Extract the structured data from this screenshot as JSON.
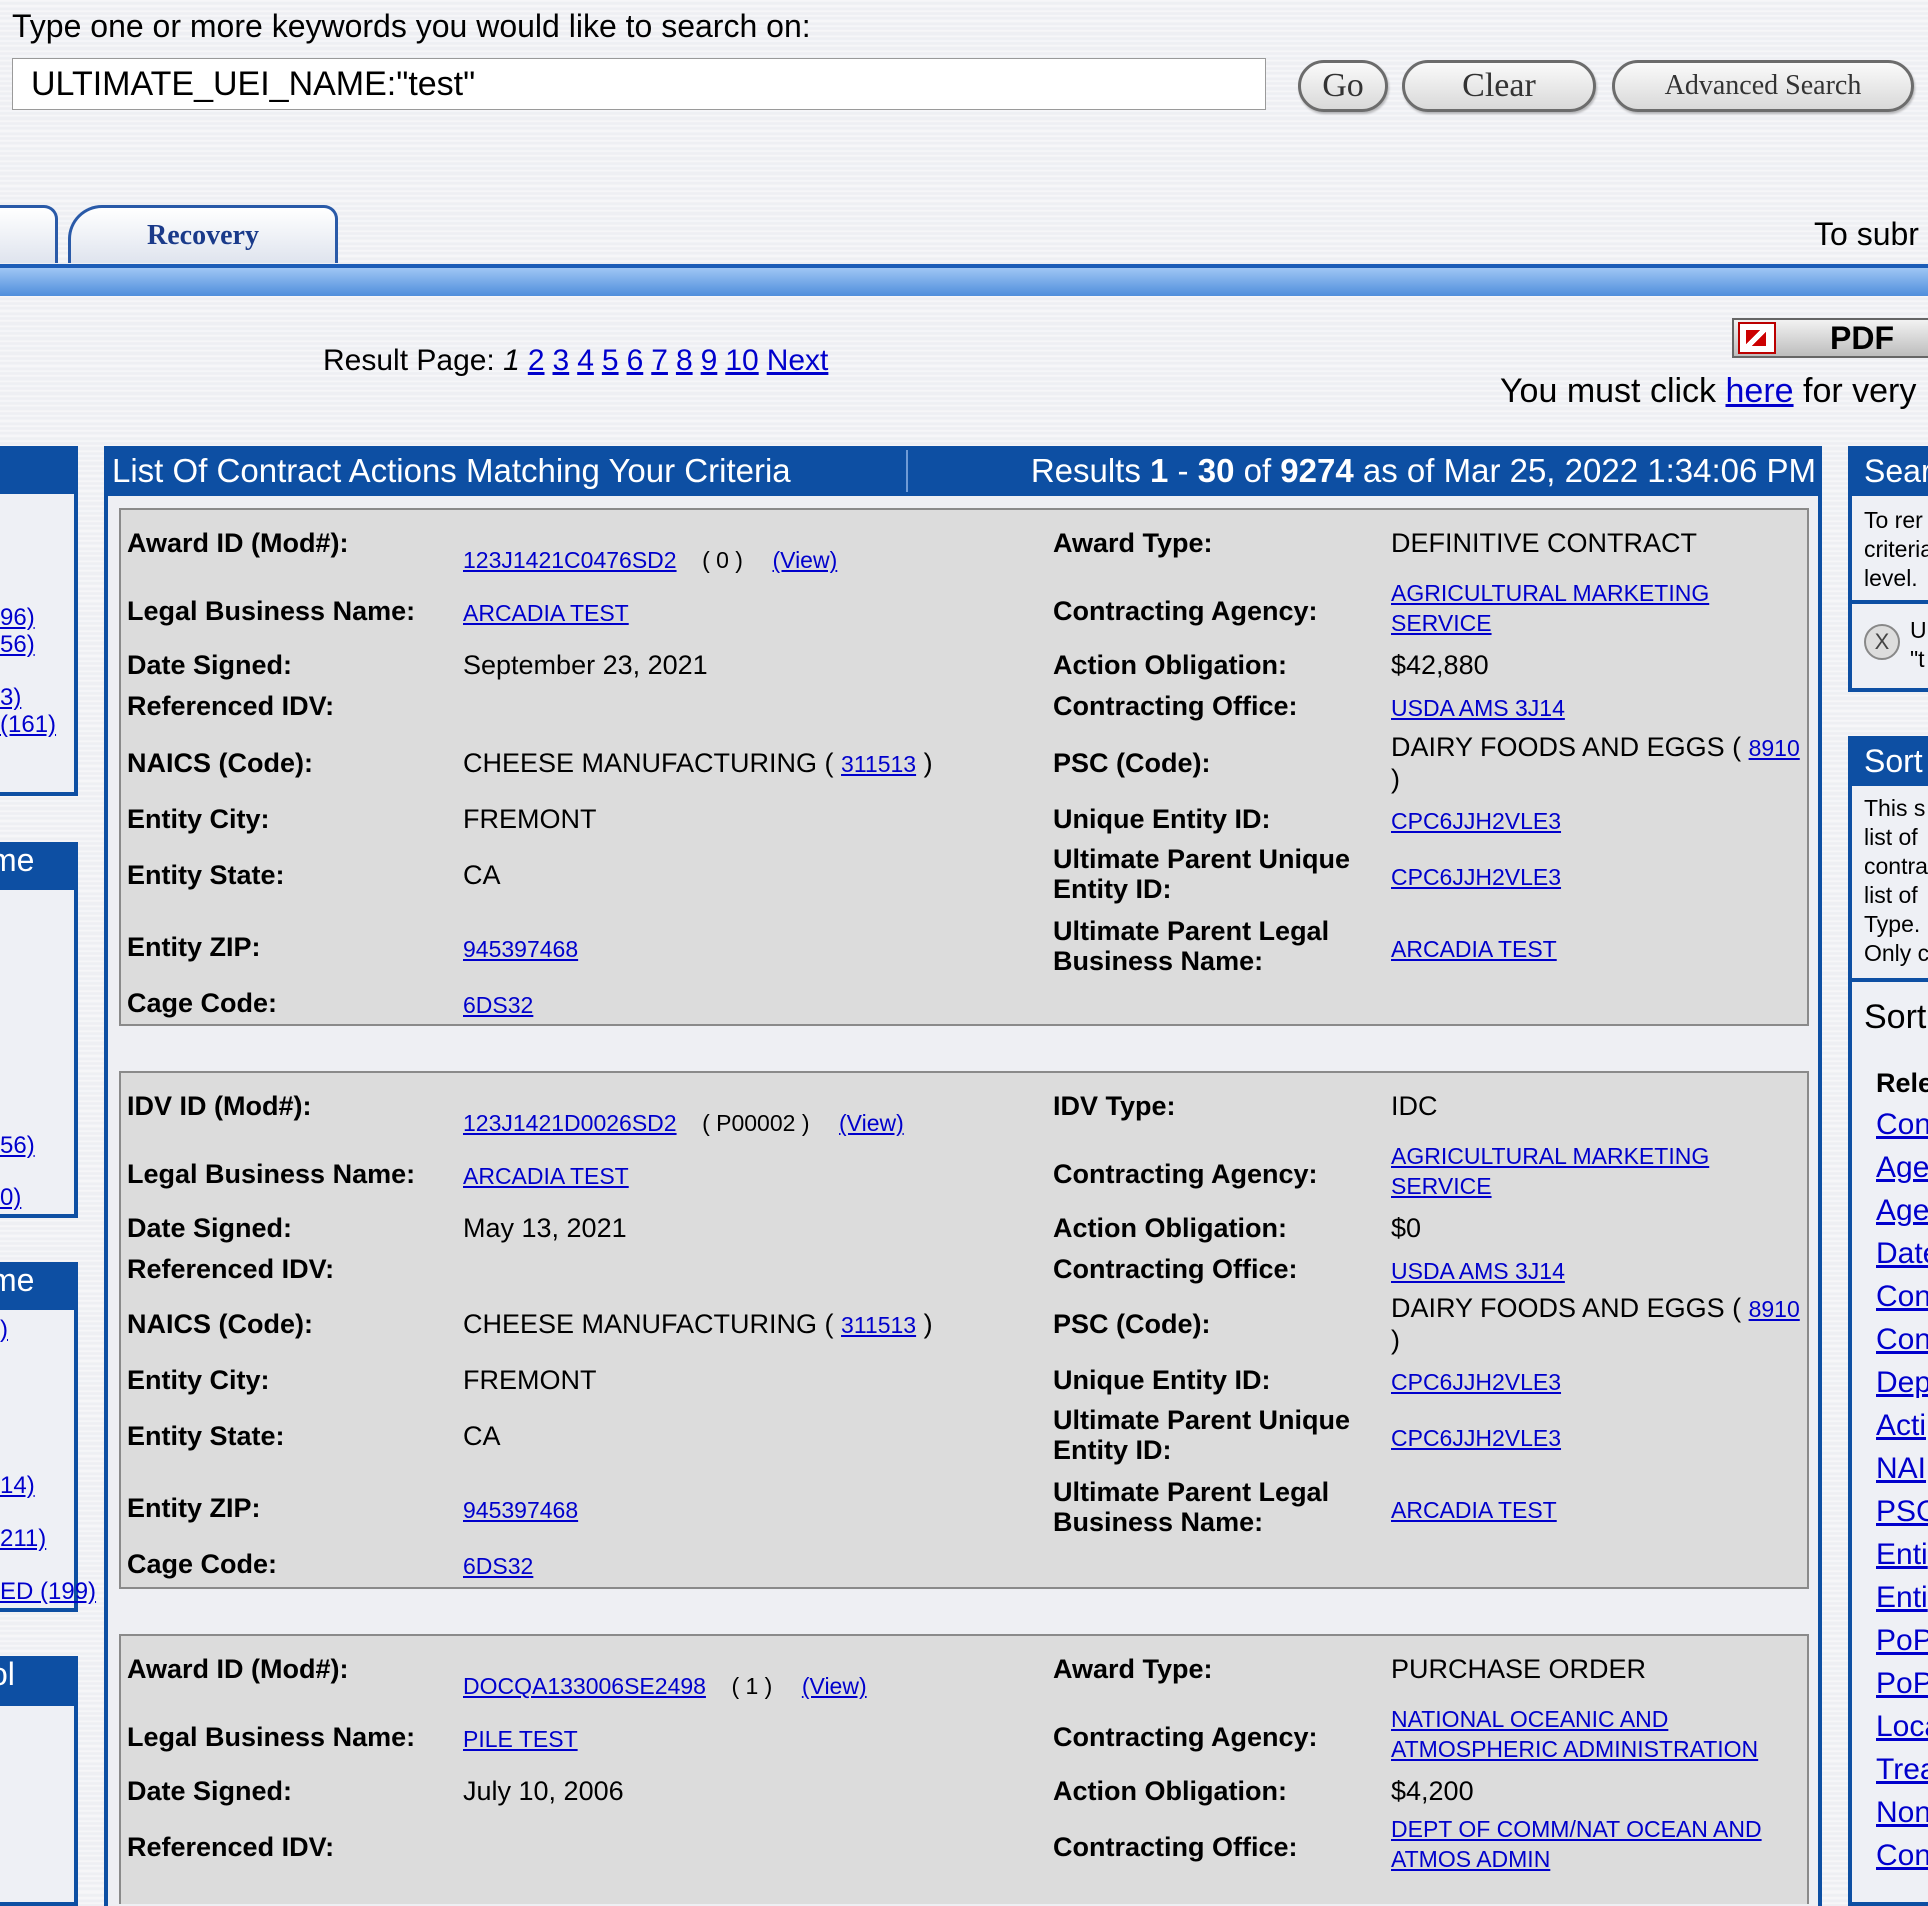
{
  "search": {
    "prompt": "Type one or more keywords you would like to search on:",
    "value": "ULTIMATE_UEI_NAME:\"test\"",
    "go_label": "Go",
    "clear_label": "Clear",
    "advanced_label": "Advanced Search"
  },
  "tabs": {
    "recovery": "Recovery"
  },
  "submit_note": "To subr",
  "pager": {
    "label": "Result Page:",
    "current": "1",
    "pages": [
      "2",
      "3",
      "4",
      "5",
      "6",
      "7",
      "8",
      "9",
      "10"
    ],
    "next": "Next"
  },
  "pdf_label": "PDF",
  "must_click": {
    "pre": "You must click ",
    "link": "here",
    "post": " for very"
  },
  "results": {
    "title": "List Of Contract Actions Matching Your Criteria",
    "summary_pre": "Results ",
    "start": "1",
    "dash": " - ",
    "end": "30",
    "of": " of ",
    "total": "9274",
    "asof": " as of Mar 25, 2022 1:34:06 PM"
  },
  "labels": {
    "award_id": "Award ID (Mod#):",
    "idv_id": "IDV ID (Mod#):",
    "legal_name": "Legal Business Name:",
    "date_signed": "Date Signed:",
    "ref_idv": "Referenced IDV:",
    "naics": "NAICS (Code):",
    "city": "Entity City:",
    "state": "Entity State:",
    "zip": "Entity ZIP:",
    "cage": "Cage Code:",
    "award_type": "Award Type:",
    "idv_type": "IDV Type:",
    "agency": "Contracting Agency:",
    "obligation": "Action Obligation:",
    "office": "Contracting Office:",
    "psc": "PSC (Code):",
    "uei": "Unique Entity ID:",
    "parent_uei_1": "Ultimate Parent Unique",
    "parent_uei_2": "Entity ID:",
    "parent_name_1": "Ultimate Parent Legal",
    "parent_name_2": "Business Name:",
    "view": "(View)"
  },
  "records": [
    {
      "id": "123J1421C0476SD2",
      "mod": "( 0 )",
      "legal_name": "ARCADIA TEST",
      "date_signed": "September 23, 2021",
      "naics_name": "CHEESE MANUFACTURING ( ",
      "naics_code": "311513",
      "naics_close": " )",
      "city": "FREMONT",
      "state": "CA",
      "zip": "945397468",
      "cage": "6DS32",
      "type": "DEFINITIVE CONTRACT",
      "agency_1": "AGRICULTURAL MARKETING",
      "agency_2": "SERVICE",
      "obligation": "$42,880",
      "office": "USDA AMS 3J14",
      "psc_name": "DAIRY FOODS AND EGGS ( ",
      "psc_code": "8910",
      "psc_close": ")",
      "uei": "CPC6JJH2VLE3",
      "parent_uei": "CPC6JJH2VLE3",
      "parent_name": "ARCADIA TEST"
    },
    {
      "id": "123J1421D0026SD2",
      "mod": "( P00002 )",
      "legal_name": "ARCADIA TEST",
      "date_signed": "May 13, 2021",
      "naics_name": "CHEESE MANUFACTURING ( ",
      "naics_code": "311513",
      "naics_close": " )",
      "city": "FREMONT",
      "state": "CA",
      "zip": "945397468",
      "cage": "6DS32",
      "type": "IDC",
      "agency_1": "AGRICULTURAL MARKETING",
      "agency_2": "SERVICE",
      "obligation": "$0",
      "office": "USDA AMS 3J14",
      "psc_name": "DAIRY FOODS AND EGGS ( ",
      "psc_code": "8910",
      "psc_close": ")",
      "uei": "CPC6JJH2VLE3",
      "parent_uei": "CPC6JJH2VLE3",
      "parent_name": "ARCADIA TEST"
    },
    {
      "id": "DOCQA133006SE2498",
      "mod": "( 1 )",
      "legal_name": "PILE TEST",
      "date_signed": "July 10, 2006",
      "type": "PURCHASE ORDER",
      "agency_1": "NATIONAL OCEANIC AND",
      "agency_2": "ATMOSPHERIC ADMINISTRATION",
      "obligation": "$4,200",
      "office_1": "DEPT OF COMM/NAT OCEAN AND",
      "office_2": "ATMOS ADMIN"
    }
  ],
  "left_sidebar": {
    "heads": [
      "me",
      "me",
      "ol"
    ],
    "links": [
      "96)",
      "56)",
      "3)",
      "(161)",
      "56)",
      "0)",
      ")",
      "14)",
      "211)",
      "ED (199)"
    ]
  },
  "right_sidebar": {
    "search_head": "Sear",
    "search_text": [
      "To rer",
      "criteria",
      "level."
    ],
    "chip_icon": "X",
    "chip_text": [
      "U",
      "\"t"
    ],
    "sort_head": "Sort",
    "sort_text": [
      "This s",
      "list of",
      "contra",
      "list of",
      "Type.",
      "Only c"
    ],
    "sort_sub": "Sort",
    "relevance": "Rele",
    "sort_links": [
      "Con",
      "Age",
      "Age",
      "Date",
      "Con",
      "Con",
      "Dep",
      "Acti",
      "NAI",
      "PSC",
      "Enti",
      "Enti",
      "PoP",
      "PoP",
      "Loca",
      "Trea",
      "Non",
      "Con"
    ]
  }
}
